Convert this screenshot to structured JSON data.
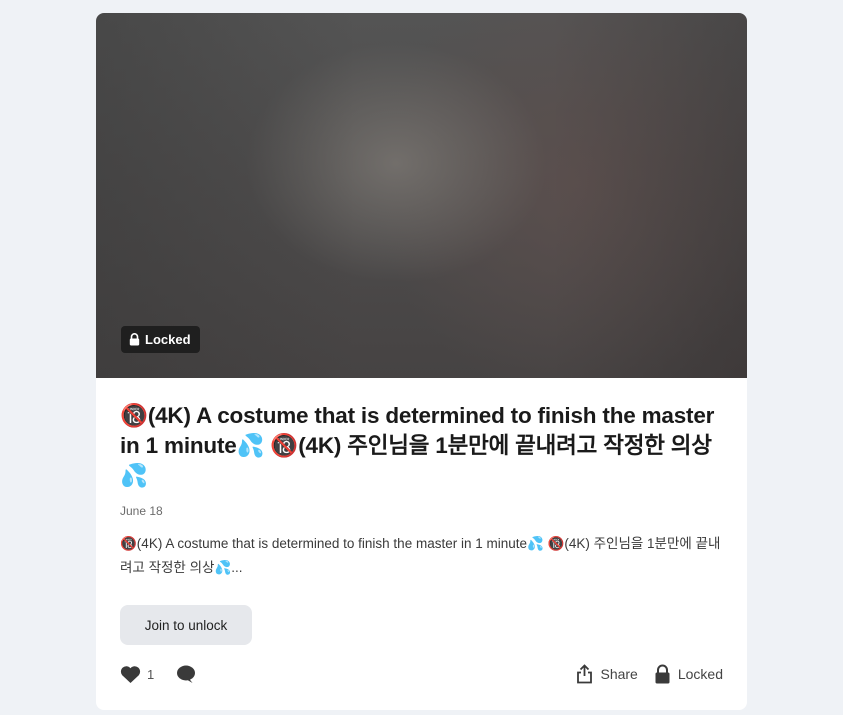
{
  "post": {
    "badge_label": "Locked",
    "title": "🔞(4K) A costume that is determined to finish the master in 1 minute💦 🔞(4K) 주인님을 1분만에 끝내려고 작정한 의상💦",
    "date": "June 18",
    "excerpt": "🔞(4K) A costume that is determined to finish the master in 1 minute💦 🔞(4K) 주인님을 1분만에 끝내려고 작정한 의상💦...",
    "join_label": "Join to unlock",
    "like_count": "1",
    "share_label": "Share",
    "locked_label": "Locked"
  },
  "icons": {
    "badge": "lock-icon",
    "like": "heart-icon",
    "comment": "comment-icon",
    "share": "share-icon",
    "locked": "lock-icon"
  },
  "colors": {
    "page_bg": "#eff2f6",
    "card_bg": "#ffffff",
    "badge_bg": "#1f1f1f",
    "button_bg": "#e6e8ec",
    "title_text": "#1a1a1a"
  }
}
